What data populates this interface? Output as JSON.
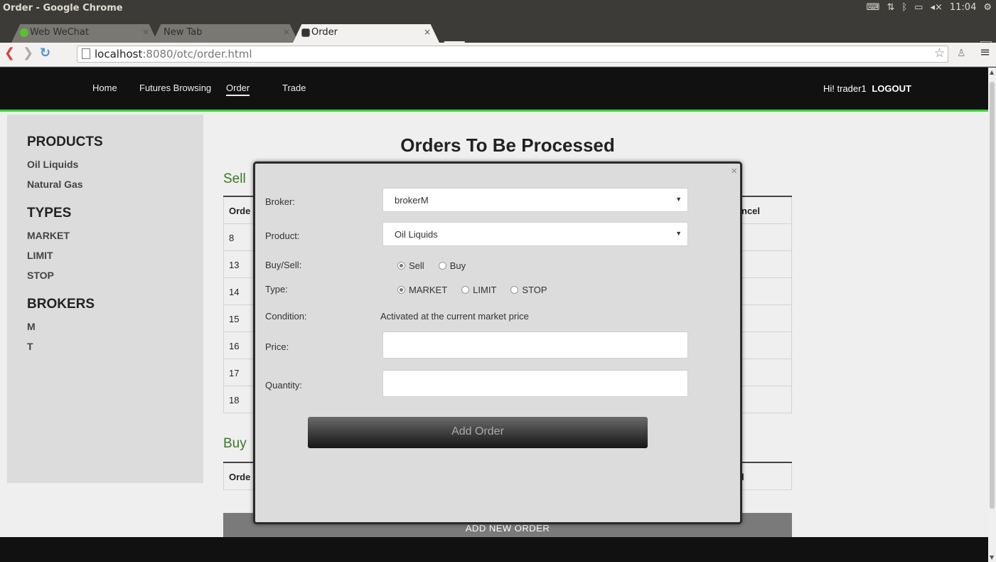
{
  "os": {
    "window_title": "Order - Google Chrome",
    "clock": "11:04"
  },
  "browser": {
    "tabs": [
      {
        "label": "Web WeChat",
        "active": false
      },
      {
        "label": "New Tab",
        "active": false
      },
      {
        "label": "Order",
        "active": true
      }
    ],
    "url_host": "localhost",
    "url_rest": ":8080/otc/order.html"
  },
  "site_nav": {
    "home": "Home",
    "futures": "Futures Browsing",
    "order": "Order",
    "trade": "Trade",
    "greeting": "Hi! trader1",
    "logout": "LOGOUT",
    "accent_color": "#3bd53b"
  },
  "sidebar": {
    "products_heading": "PRODUCTS",
    "products": [
      "Oil Liquids",
      "Natural Gas"
    ],
    "types_heading": "TYPES",
    "types": [
      "MARKET",
      "LIMIT",
      "STOP"
    ],
    "brokers_heading": "BROKERS",
    "brokers": [
      "M",
      "T"
    ]
  },
  "main": {
    "title": "Orders To Be Processed",
    "sell_label": "Sell",
    "buy_label": "Buy",
    "sell_header_left": "Orde",
    "sell_header_right": "ncel",
    "sell_rows": [
      "8",
      "13",
      "14",
      "15",
      "16",
      "17",
      "18"
    ],
    "buy_header_left": "Orde",
    "buy_header_right": "l",
    "add_new_order": "ADD NEW ORDER"
  },
  "modal": {
    "broker_label": "Broker:",
    "broker_value": "brokerM",
    "product_label": "Product:",
    "product_value": "Oil Liquids",
    "buysell_label": "Buy/Sell:",
    "sell_option": "Sell",
    "buy_option": "Buy",
    "buysell_selected": "Sell",
    "type_label": "Type:",
    "market_option": "MARKET",
    "limit_option": "LIMIT",
    "stop_option": "STOP",
    "type_selected": "MARKET",
    "condition_label": "Condition:",
    "condition_text": "Activated at the current market price",
    "price_label": "Price:",
    "price_value": "",
    "quantity_label": "Quantity:",
    "quantity_value": "",
    "submit_label": "Add Order",
    "close_glyph": "×"
  }
}
